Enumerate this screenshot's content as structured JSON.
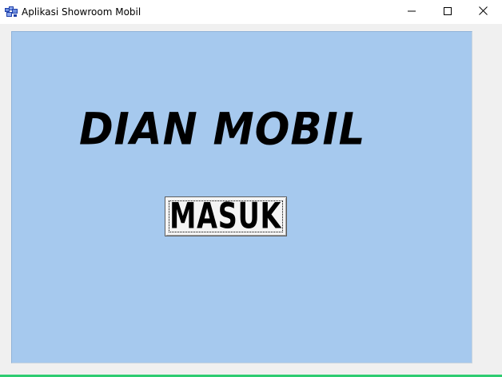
{
  "window": {
    "title": "Aplikasi Showroom Mobil",
    "icon": "vb-form-icon",
    "controls": {
      "minimize_icon": "minimize-icon",
      "maximize_icon": "maximize-icon",
      "close_icon": "close-icon"
    }
  },
  "form": {
    "heading": "DIAN MOBIL",
    "enter_button_label": "MASUK",
    "background_color": "#a6c9ee"
  }
}
